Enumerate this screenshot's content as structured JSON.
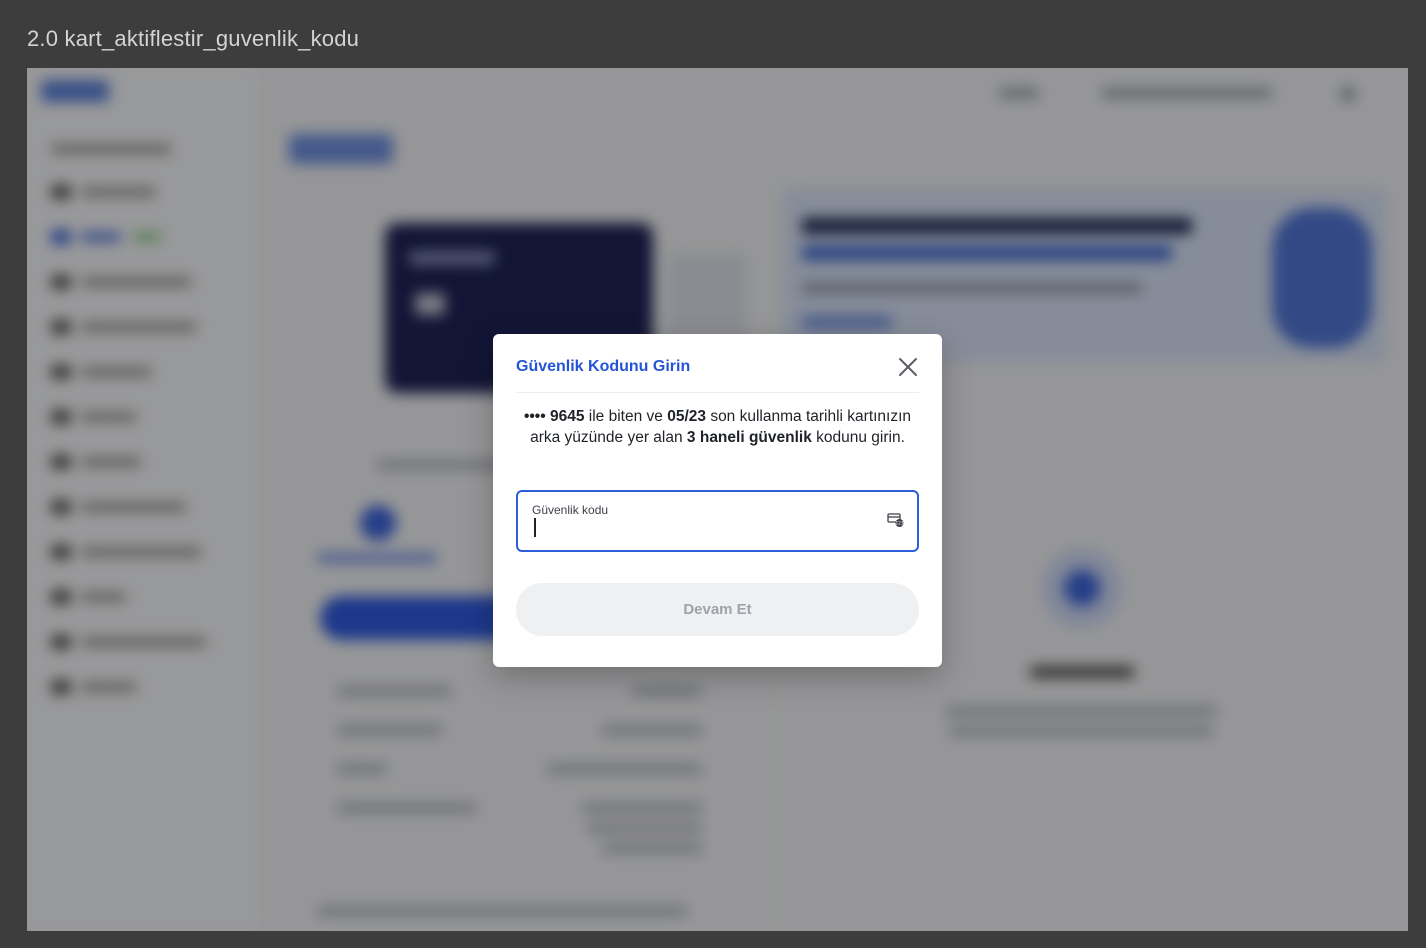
{
  "frame": {
    "title": "2.0 kart_aktiflestir_guvenlik_kodu"
  },
  "modal": {
    "title": "Güvenlik Kodunu Girin",
    "description": {
      "masked_dots": "••••",
      "card_last4": "9645",
      "text_1": "ile biten ve",
      "expiry": "05/23",
      "text_2": "son kullanma tarihli kartınızın arka yüzünde yer alan",
      "digits_emphasis": "3 haneli güvenlik",
      "text_3": "kodunu girin."
    },
    "security_field": {
      "label": "Güvenlik kodu",
      "value": "",
      "icon": "card-cvv-icon"
    },
    "continue_label": "Devam Et",
    "close_icon": "close-icon"
  },
  "colors": {
    "accent": "#2455d6",
    "field_border": "#2d5ddb",
    "button_disabled_bg": "#eff0f2",
    "button_disabled_text": "#9ea3ab"
  }
}
